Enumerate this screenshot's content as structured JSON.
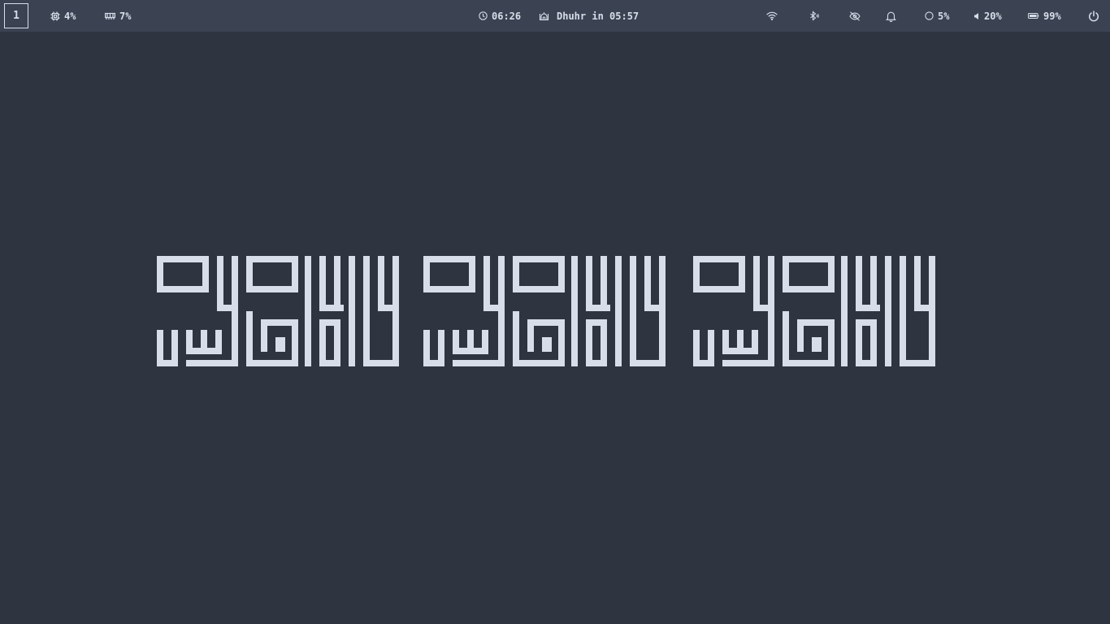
{
  "bar": {
    "workspace": "1",
    "cpu": {
      "icon": "cpu-icon",
      "value": "4%"
    },
    "memory": {
      "icon": "memory-icon",
      "value": "7%"
    },
    "clock": {
      "icon": "clock-icon",
      "value": "06:26"
    },
    "prayer": {
      "icon": "mosque-icon",
      "value": "Dhuhr in 05:57"
    },
    "wifi": {
      "icon": "wifi-icon"
    },
    "bluetooth": {
      "icon": "bluetooth-icon"
    },
    "idle_inhibitor": {
      "icon": "eye-off-icon"
    },
    "notifications": {
      "icon": "bell-icon"
    },
    "brightness": {
      "icon": "brightness-icon",
      "value": "5%"
    },
    "volume": {
      "icon": "volume-icon",
      "value": "20%"
    },
    "battery": {
      "icon": "battery-icon",
      "value": "99%"
    },
    "power": {
      "icon": "power-icon"
    }
  },
  "colors": {
    "bar_bg": "#3b4252",
    "desktop_bg": "#2e3440",
    "foreground": "#d8dee9"
  },
  "wallpaper": {
    "type": "square-kufic-calligraphy",
    "repeats": 3
  }
}
